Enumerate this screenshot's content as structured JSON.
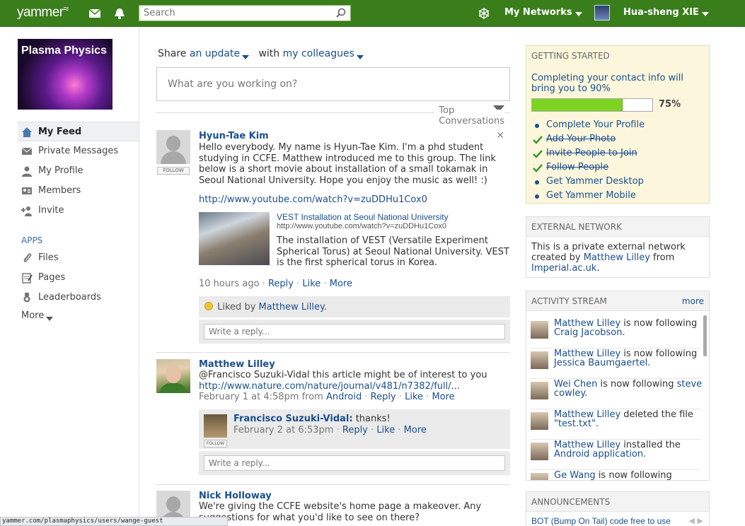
{
  "topbar": {
    "logo": "yammer",
    "search_placeholder": "Search",
    "my_networks": "My Networks",
    "user_name": "Hua-sheng XIE"
  },
  "sidebar": {
    "group_name": "Plasma Physics",
    "items": [
      {
        "label": "My Feed",
        "icon": "home-icon"
      },
      {
        "label": "Private Messages",
        "icon": "envelope-icon"
      },
      {
        "label": "My Profile",
        "icon": "person-icon"
      },
      {
        "label": "Members",
        "icon": "members-card-icon"
      },
      {
        "label": "Invite",
        "icon": "invite-person-icon"
      }
    ],
    "apps_label": "APPS",
    "apps": [
      {
        "label": "Files",
        "icon": "paperclip-icon"
      },
      {
        "label": "Pages",
        "icon": "pages-icon"
      },
      {
        "label": "Leaderboards",
        "icon": "medal-icon"
      }
    ],
    "more": "More"
  },
  "composer": {
    "share": "Share",
    "an_update": "an update",
    "with": "with",
    "my_colleagues": "my colleagues",
    "placeholder": "What are you working on?",
    "top_conversations": "Top Conversations"
  },
  "posts": [
    {
      "author": "Hyun-Tae Kim",
      "follow": "FOLLOW",
      "text": "Hello everybody. My name is Hyun-Tae Kim. I'm a phd student studying in CCFE. Matthew introduced me to this group. The link below is a short movie about installation of a small tokamak in Seoul National University. Hope you enjoy the music as well! :)",
      "link": "http://www.youtube.com/watch?v=zuDDHu1Cox0",
      "attachment_title": "VEST Installation at Seoul National University",
      "attachment_url": "http://www.youtube.com/watch?v=zuDDHu1Cox0",
      "attachment_desc": "The installation of VEST (Versatile Experiment Spherical Torus) at Seoul National University. VEST is the first spherical torus in Korea.",
      "time": "10 hours ago",
      "reply": "Reply",
      "like": "Like",
      "more": "More",
      "liked_by_prefix": "Liked by",
      "liked_by": "Matthew Lilley",
      "reply_placeholder": "Write a reply..."
    },
    {
      "author": "Matthew Lilley",
      "text": "@Francisco Suzuki-Vidal this article might be of interest to you",
      "link": "http://www.nature.com/nature/journal/v481/n7382/full/...",
      "time": "February 1 at 4:58pm from",
      "source": "Android",
      "reply": "Reply",
      "like": "Like",
      "more": "More",
      "reply_author": "Francisco Suzuki-Vidal:",
      "reply_text": "thanks!",
      "reply_follow": "FOLLOW",
      "reply_time": "February 2 at 6:53pm",
      "reply_placeholder": "Write a reply..."
    },
    {
      "author": "Nick Holloway",
      "text": "We're giving the CCFE website's home page a makeover. Any suggestions for what you'd like to see on there?"
    }
  ],
  "getting_started": {
    "title": "GETTING STARTED",
    "intro": "Completing your contact info will bring you to 90%",
    "progress_percent": 75,
    "progress_label": "75%",
    "items": [
      {
        "label": "Complete Your Profile",
        "done": false
      },
      {
        "label": "Add Your Photo",
        "done": true
      },
      {
        "label": "Invite People to Join",
        "done": true
      },
      {
        "label": "Follow People",
        "done": true
      },
      {
        "label": "Get Yammer Desktop",
        "done": false
      },
      {
        "label": "Get Yammer Mobile",
        "done": false
      }
    ]
  },
  "external_network": {
    "title": "EXTERNAL NETWORK",
    "text_prefix": "This is a private external network created by",
    "creator": "Matthew Lilley",
    "from": "from",
    "org": "Imperial.ac.uk",
    "period": "."
  },
  "activity_stream": {
    "title": "ACTIVITY STREAM",
    "more": "more",
    "items": [
      {
        "actor": "Matthew Lilley",
        "action": "is now following",
        "target": "Craig Jacobson."
      },
      {
        "actor": "Matthew Lilley",
        "action": "is now following",
        "target": "Jessica Baumgaertel."
      },
      {
        "actor": "Wei Chen",
        "action": "is now following",
        "target": "steve cowley."
      },
      {
        "actor": "Matthew Lilley",
        "action": "deleted the file",
        "target": "\"test.txt\"."
      },
      {
        "actor": "Matthew Lilley",
        "action": "installed the",
        "target": "Android application."
      },
      {
        "actor": "Ge Wang",
        "action": "is now following",
        "target": ""
      }
    ]
  },
  "announcements": {
    "title": "ANNOUNCEMENTS",
    "item": "BOT (Bump On Tail) code free to use"
  },
  "status_url": "yammer.com/plasmaphysics/users/wange-guest"
}
